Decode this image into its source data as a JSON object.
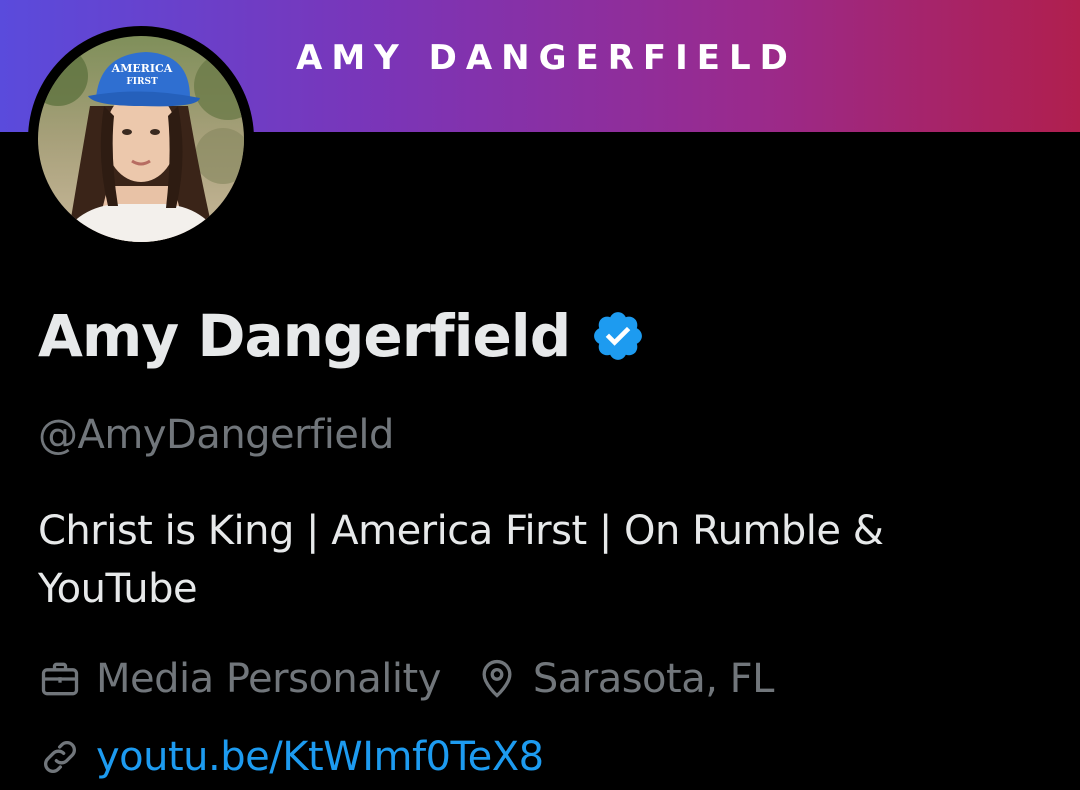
{
  "banner": {
    "title": "AMY DANGERFIELD"
  },
  "profile": {
    "display_name": "Amy Dangerfield",
    "handle": "@AmyDangerfield",
    "verified": true,
    "bio": "Christ is King | America First | On Rumble & YouTube",
    "profession": "Media Personality",
    "location": "Sarasota, FL",
    "website": "youtu.be/KtWImf0TeX8",
    "avatar_hat_text": "AMERICA FIRST"
  },
  "icons": {
    "verified": "verified-badge-icon",
    "profession": "briefcase-icon",
    "location": "location-pin-icon",
    "link": "link-icon"
  },
  "colors": {
    "background": "#000000",
    "primary_text": "#e7e9ea",
    "secondary_text": "#71767b",
    "link": "#1d9bf0",
    "verified": "#1d9bf0",
    "banner_start": "#5a4bdc",
    "banner_end": "#b01f4e"
  }
}
